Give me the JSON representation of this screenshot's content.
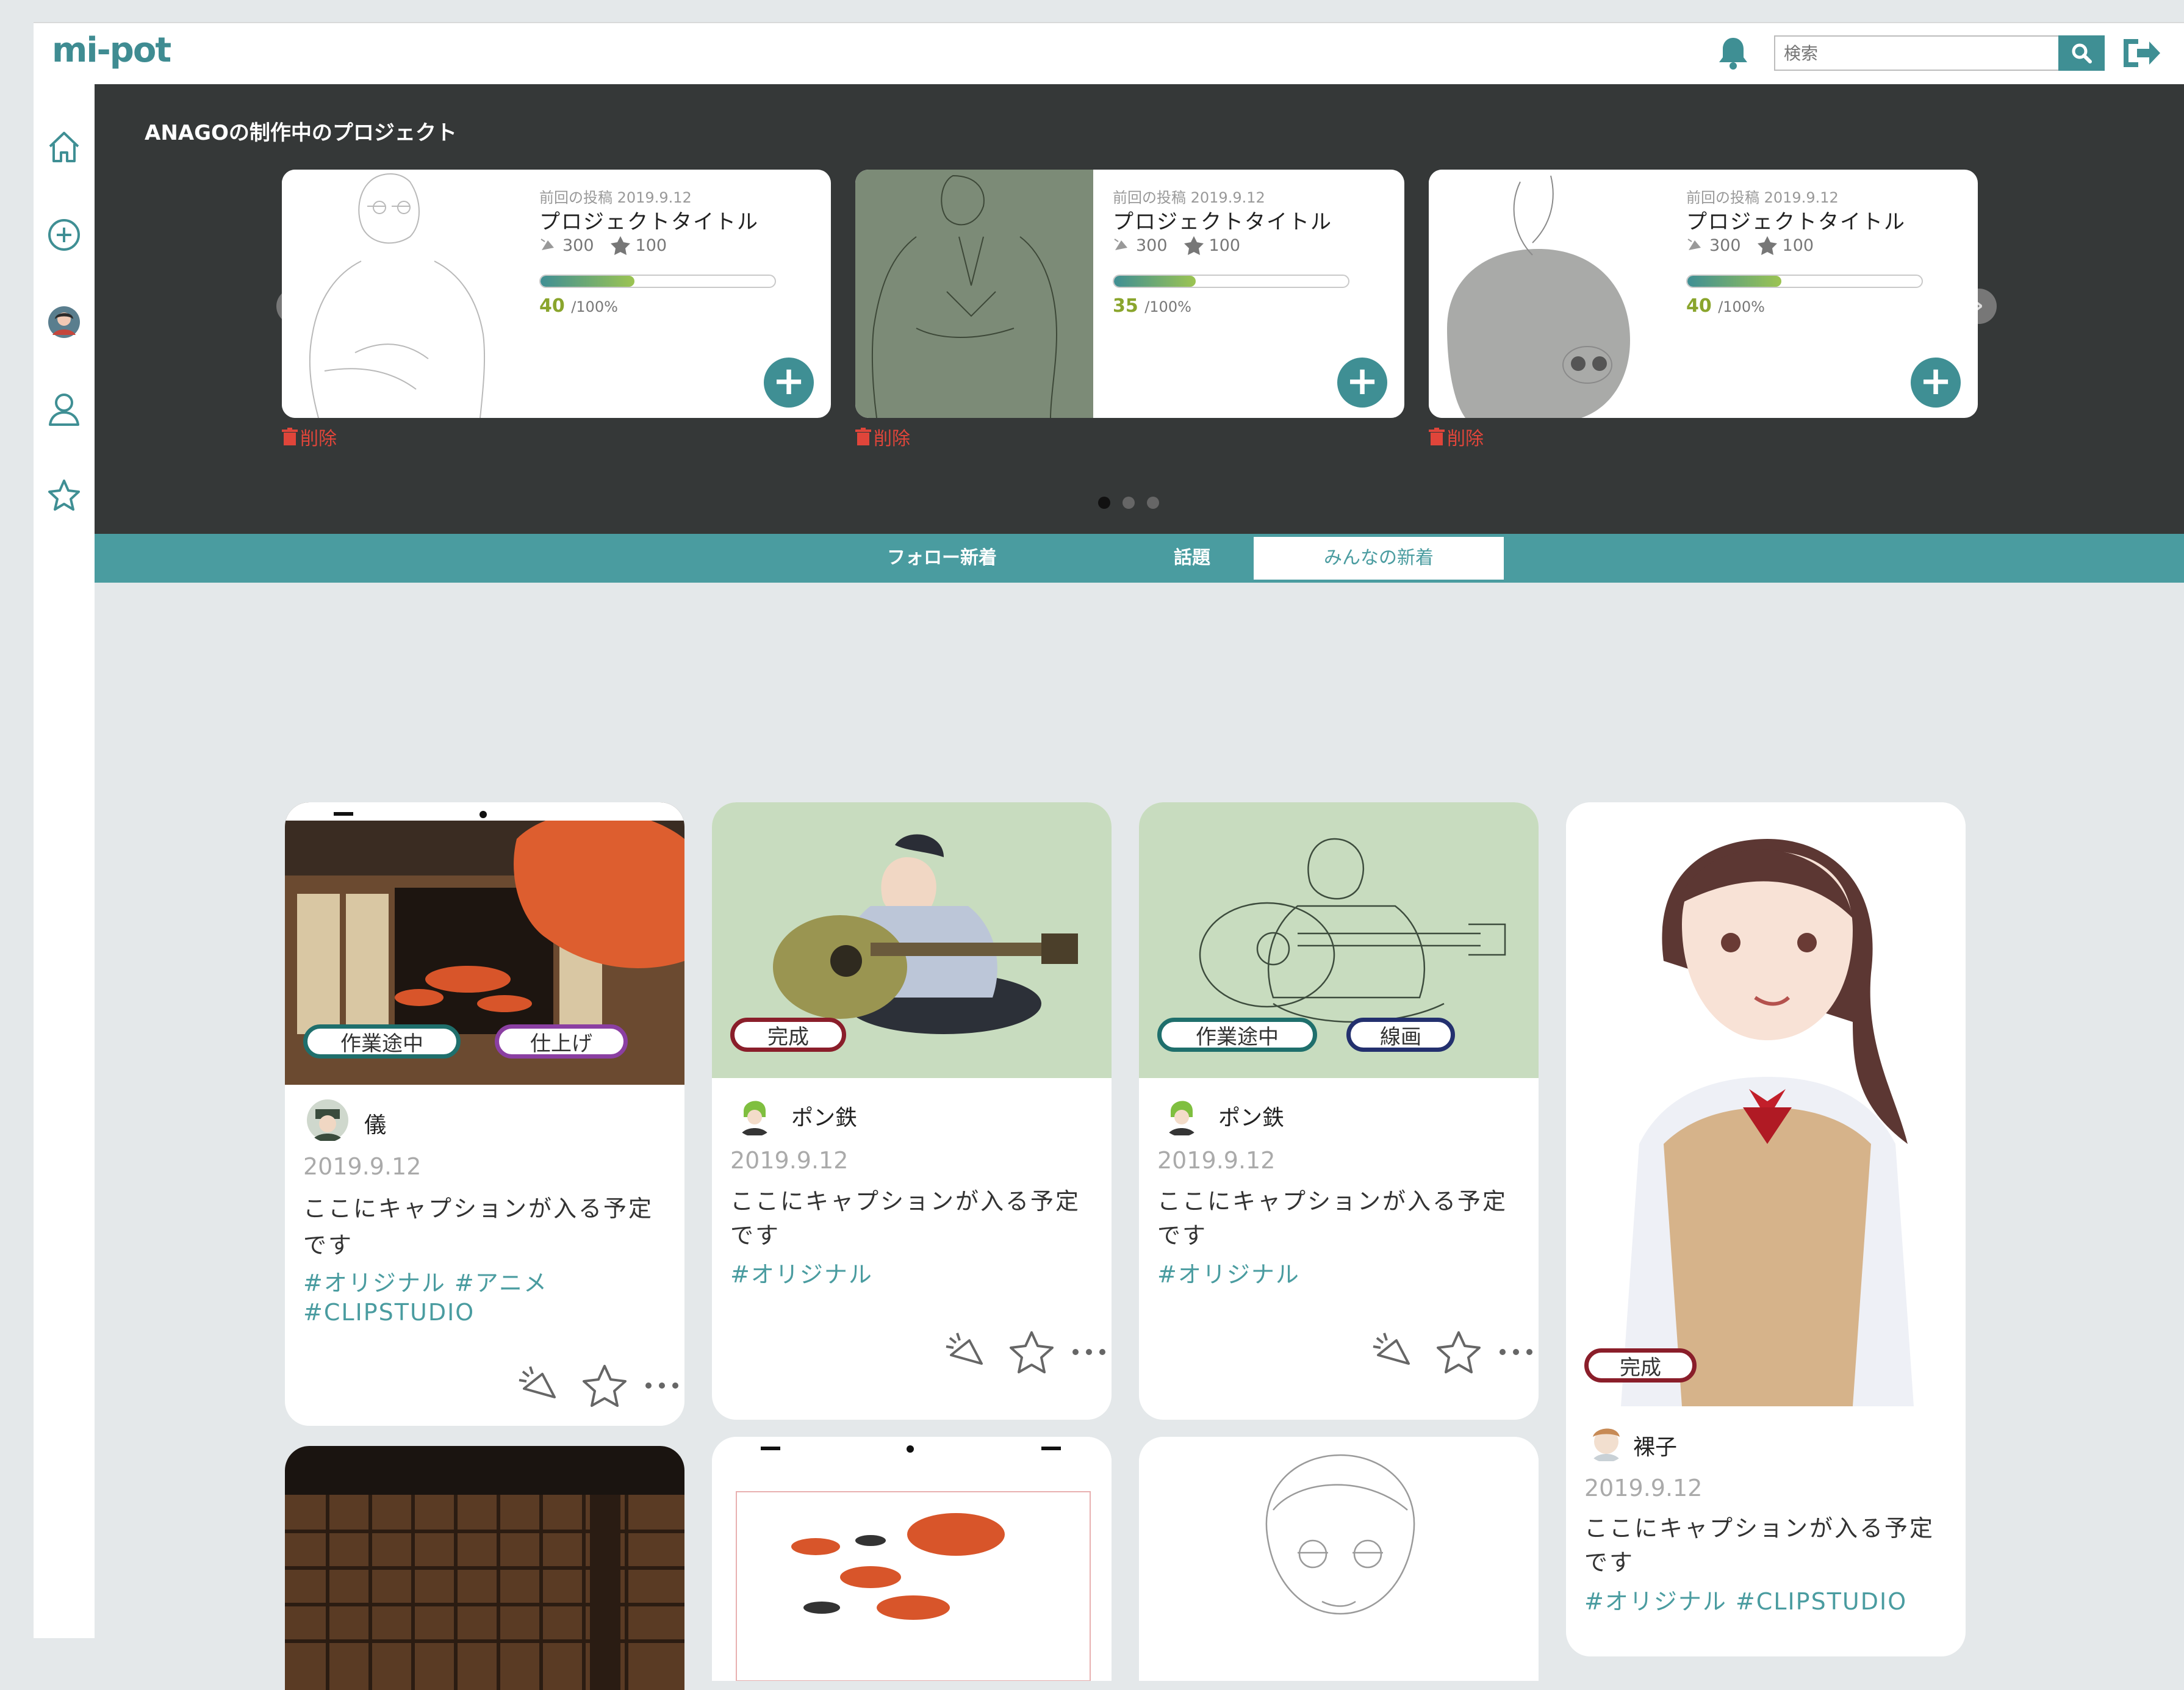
{
  "header": {
    "logo": "mi-pot",
    "search_placeholder": "検索"
  },
  "sidebar": {
    "items": [
      "home",
      "create",
      "avatar",
      "profile",
      "favorites"
    ]
  },
  "projects": {
    "title": "ANAGOの制作中のプロジェクト",
    "delete_label": "削除",
    "cards": [
      {
        "date": "前回の投稿 2019.9.12",
        "title": "プロジェクトタイトル",
        "likes": "300",
        "stars": "100",
        "progress_value": "40",
        "progress_suffix": "/100%",
        "progress": 0.4
      },
      {
        "date": "前回の投稿 2019.9.12",
        "title": "プロジェクトタイトル",
        "likes": "300",
        "stars": "100",
        "progress_value": "35",
        "progress_suffix": "/100%",
        "progress": 0.35
      },
      {
        "date": "前回の投稿 2019.9.12",
        "title": "プロジェクトタイトル",
        "likes": "300",
        "stars": "100",
        "progress_value": "40",
        "progress_suffix": "/100%",
        "progress": 0.4
      }
    ],
    "pages": 3,
    "active_page": 1
  },
  "tabs": [
    "フォロー新着",
    "話題",
    "みんなの新着"
  ],
  "active_tab": 2,
  "feed": [
    {
      "user": "儀",
      "date": "2019.9.12",
      "caption": "ここにキャプションが入る予定です",
      "tags_line1": "#オリジナル  #アニメ",
      "tags_line2": "#CLIPSTUDIO",
      "badges": [
        "作業途中",
        "仕上げ"
      ]
    },
    {
      "user": "ポン鉄",
      "date": "2019.9.12",
      "caption": "ここにキャプションが入る予定です",
      "tags_line1": "#オリジナル",
      "badges": [
        "完成"
      ]
    },
    {
      "user": "ポン鉄",
      "date": "2019.9.12",
      "caption": "ここにキャプションが入る予定です",
      "tags_line1": "#オリジナル",
      "badges": [
        "作業途中",
        "線画"
      ]
    },
    {
      "user": "裸子",
      "date": "2019.9.12",
      "caption": "ここにキャプションが入る予定です",
      "tags_line1": "#オリジナル  #CLIPSTUDIO",
      "badges": [
        "完成"
      ]
    }
  ],
  "colors": {
    "teal": "#4a9ca0",
    "dark_band": "#353838",
    "delete_red": "#e0453a"
  }
}
